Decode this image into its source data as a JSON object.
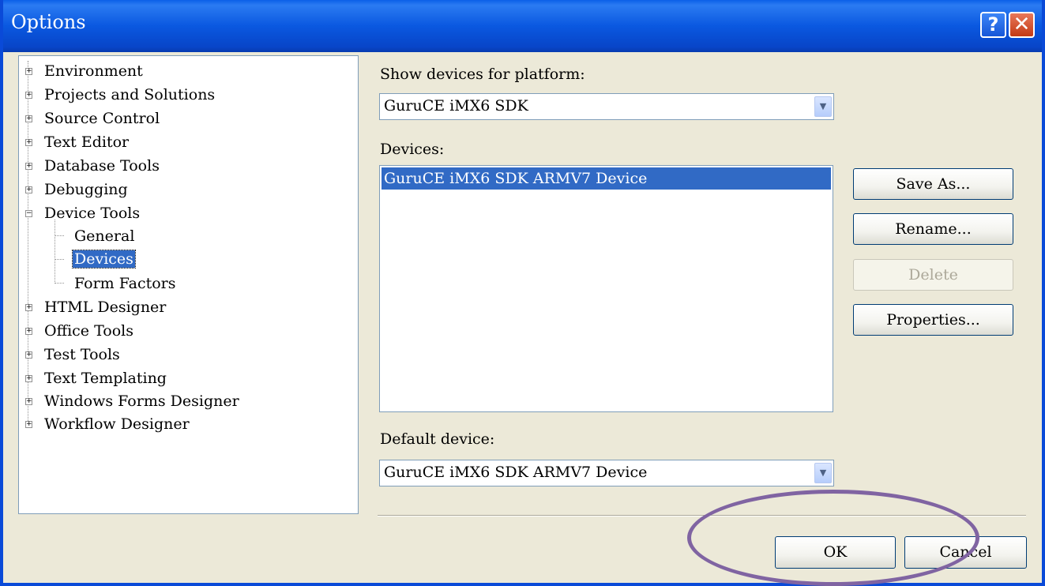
{
  "window": {
    "title": "Options"
  },
  "titlebar": {
    "help": "?",
    "close": "✕"
  },
  "tree": {
    "items": [
      {
        "label": "Environment",
        "expander": "+"
      },
      {
        "label": "Projects and Solutions",
        "expander": "+"
      },
      {
        "label": "Source Control",
        "expander": "+"
      },
      {
        "label": "Text Editor",
        "expander": "+"
      },
      {
        "label": "Database Tools",
        "expander": "+"
      },
      {
        "label": "Debugging",
        "expander": "+"
      },
      {
        "label": "Device Tools",
        "expander": "−"
      },
      {
        "label": "General"
      },
      {
        "label": "Devices",
        "selected": true
      },
      {
        "label": "Form Factors"
      },
      {
        "label": "HTML Designer",
        "expander": "+"
      },
      {
        "label": "Office Tools",
        "expander": "+"
      },
      {
        "label": "Test Tools",
        "expander": "+"
      },
      {
        "label": "Text Templating",
        "expander": "+"
      },
      {
        "label": "Windows Forms Designer",
        "expander": "+"
      },
      {
        "label": "Workflow Designer",
        "expander": "+"
      }
    ]
  },
  "platform": {
    "label": "Show devices for platform:",
    "value": "GuruCE iMX6 SDK"
  },
  "devices": {
    "label": "Devices:",
    "items": [
      "GuruCE iMX6 SDK ARMV7 Device"
    ]
  },
  "buttons": {
    "save_as": "Save As...",
    "rename": "Rename...",
    "delete": "Delete",
    "properties": "Properties...",
    "ok": "OK",
    "cancel": "Cancel"
  },
  "default_device": {
    "label": "Default device:",
    "value": "GuruCE iMX6 SDK ARMV7 Device"
  },
  "colors": {
    "selection": "#316ac5",
    "titlebar": "#0a58e0",
    "annotation": "#8064a2",
    "face": "#ece9d8"
  }
}
